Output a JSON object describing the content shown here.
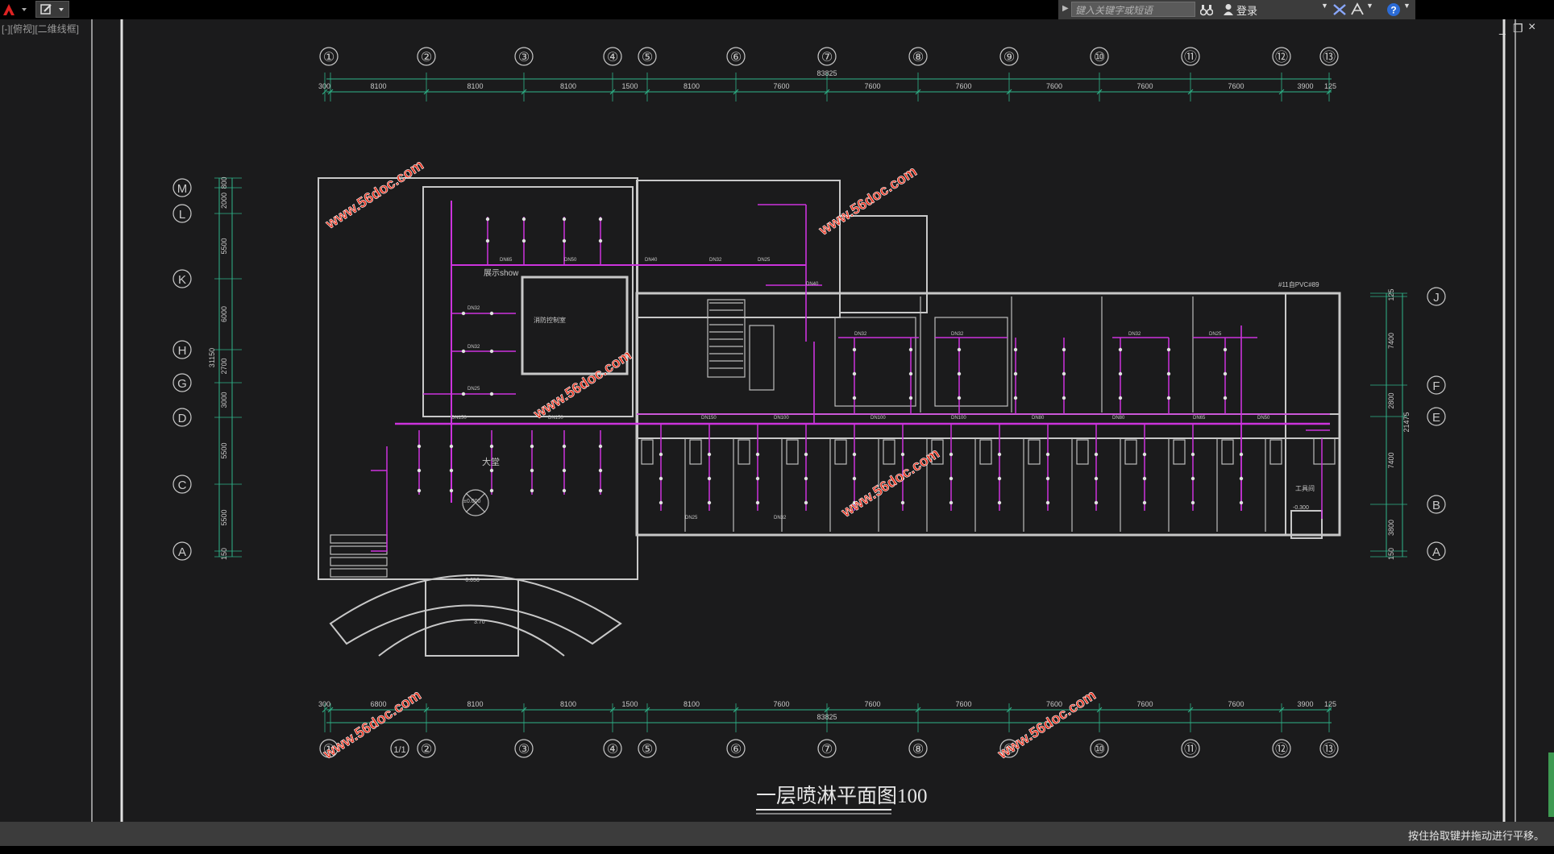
{
  "toolbar": {
    "search_placeholder": "键入关键字或短语",
    "login_label": "登录",
    "help_icon": "help-icon"
  },
  "viewport": {
    "label": "[-][俯视][二维线框]"
  },
  "window_controls": {
    "restore": "▫",
    "close": "×"
  },
  "drawing": {
    "columns": [
      "①",
      "②",
      "③",
      "④",
      "⑤",
      "⑥",
      "⑦",
      "⑧",
      "⑨",
      "⑩",
      "⑪",
      "⑫",
      "⑬"
    ],
    "col_extra": "1/1",
    "rows_left": [
      "M",
      "L",
      "K",
      "H",
      "G",
      "D",
      "C",
      "A"
    ],
    "rows_right": [
      "J",
      "F",
      "E",
      "B",
      "A"
    ],
    "top_total": "83825",
    "top_dims": [
      "300",
      "8100",
      "8100",
      "8100",
      "1500",
      "8100",
      "7600",
      "7600",
      "7600",
      "7600",
      "7600",
      "7600",
      "3900",
      "125"
    ],
    "bottom_dims": [
      "300",
      "6800",
      "8100",
      "8100",
      "1500",
      "8100",
      "7600",
      "7600",
      "7600",
      "7600",
      "7600",
      "7600",
      "3900",
      "125"
    ],
    "bottom_total": "83825",
    "left_total": "31150",
    "left_dims": [
      "800",
      "2000",
      "5500",
      "6000",
      "2700",
      "3000",
      "5500",
      "5500",
      "150"
    ],
    "right_total": "21475",
    "right_dims": [
      "125",
      "7400",
      "2800",
      "7400",
      "3800",
      "150"
    ],
    "title": "一层喷淋平面图100",
    "watermark": "www.56doc.com",
    "labels": {
      "dn150": "DN150",
      "dn100": "DN100",
      "dn80": "DN80",
      "dn65": "DN65",
      "dn50": "DN50",
      "dn40": "DN40",
      "dn32": "DN32",
      "dn25": "DN25",
      "hall": "大堂",
      "show": "展示show",
      "lift": "消防控制室",
      "note": "#11自PVC#89",
      "workroom": "工具间",
      "elev1": "-0.300",
      "elev2": "±0.000",
      "elev3": "-0.050",
      "elev4": "3.70"
    }
  },
  "status": {
    "text": "按住拾取键并拖动进行平移。"
  },
  "colors": {
    "background": "#1b1b1c",
    "walls": "#c8c8c8",
    "pipes": "#cc33dd",
    "dims": "#2fb58a",
    "watermark": "#e8301c"
  }
}
